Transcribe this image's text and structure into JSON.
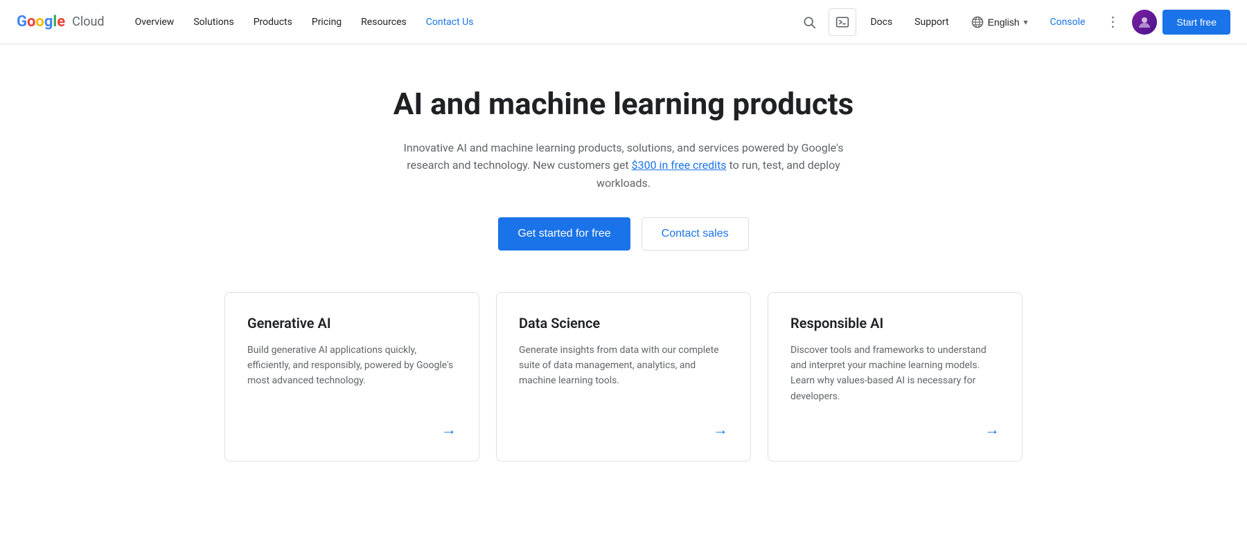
{
  "brand": {
    "google": {
      "g": "G",
      "o1": "o",
      "o2": "o",
      "g2": "g",
      "l": "l",
      "e": "e"
    },
    "cloud": "Cloud"
  },
  "navbar": {
    "links": [
      {
        "label": "Overview",
        "active": false
      },
      {
        "label": "Solutions",
        "active": false
      },
      {
        "label": "Products",
        "active": false
      },
      {
        "label": "Pricing",
        "active": false
      },
      {
        "label": "Resources",
        "active": false
      },
      {
        "label": "Contact Us",
        "active": true
      }
    ],
    "docs_label": "Docs",
    "support_label": "Support",
    "language_label": "English",
    "console_label": "Console",
    "start_free_label": "Start free"
  },
  "hero": {
    "title": "AI and machine learning products",
    "description_part1": "Innovative AI and machine learning products, solutions, and services powered by Google's research and technology. New customers get ",
    "credits_link_text": "$300 in free credits",
    "description_part2": " to run, test, and deploy workloads.",
    "btn_primary": "Get started for free",
    "btn_secondary": "Contact sales"
  },
  "cards": [
    {
      "id": "generative-ai",
      "title": "Generative AI",
      "description": "Build generative AI applications quickly, efficiently, and responsibly, powered by Google's most advanced technology.",
      "arrow": "→"
    },
    {
      "id": "data-science",
      "title": "Data Science",
      "description": "Generate insights from data with our complete suite of data management, analytics, and machine learning tools.",
      "arrow": "→"
    },
    {
      "id": "responsible-ai",
      "title": "Responsible AI",
      "description": "Discover tools and frameworks to understand and interpret your machine learning models. Learn why values-based AI is necessary for developers.",
      "arrow": "→"
    }
  ]
}
